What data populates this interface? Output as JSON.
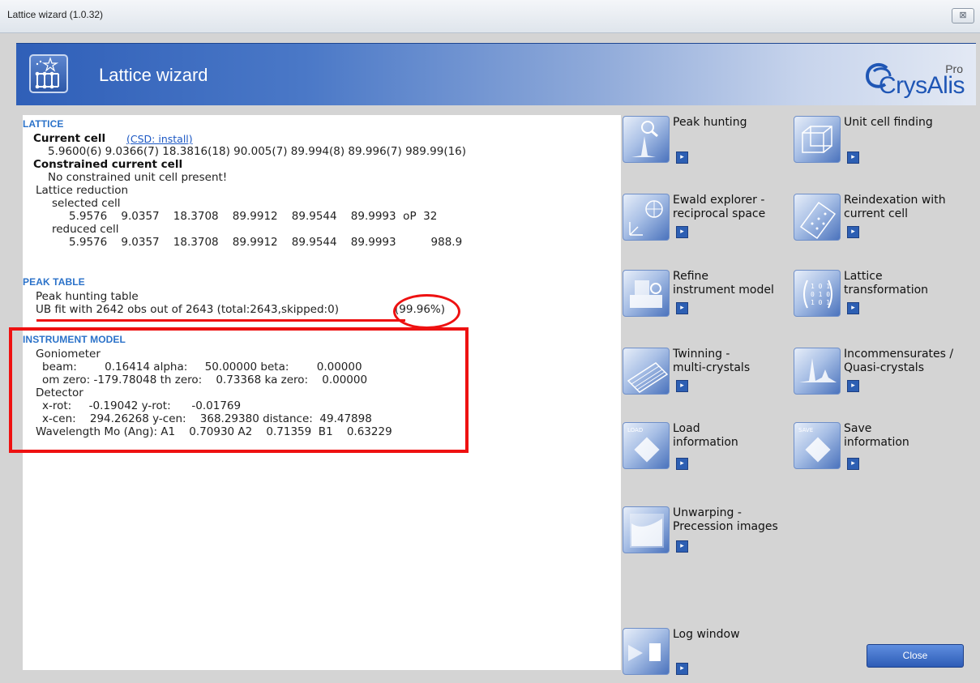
{
  "window": {
    "title": "Lattice wizard (1.0.32)",
    "close_glyph": "⊠"
  },
  "banner": {
    "title": "Lattice wizard",
    "logo_pro": "Pro",
    "logo_name": "CrysAlis",
    "accent": "#2f5fb8"
  },
  "lattice": {
    "heading": "LATTICE",
    "current_cell_label": "Current cell",
    "csd_link": "(CSD: install)",
    "current_cell_values": "5.9600(6) 9.0366(7) 18.3816(18) 90.005(7) 89.994(8) 89.996(7) 989.99(16)",
    "constrained_label": "Constrained current cell",
    "constrained_msg": "No constrained unit cell present!",
    "reduction_label": "Lattice reduction",
    "selected_label": "selected cell",
    "selected_values": "5.9576    9.0357    18.3708    89.9912    89.9544    89.9993  oP  32",
    "reduced_label": "reduced cell",
    "reduced_values": "5.9576    9.0357    18.3708    89.9912    89.9544    89.9993          988.9"
  },
  "peak": {
    "heading": "PEAK TABLE",
    "table_name": "Peak hunting table",
    "ub_fit": "UB fit with 2642 obs out of 2643 (total:2643,skipped:0)",
    "percent": "(99.96%)"
  },
  "instrument": {
    "heading": "INSTRUMENT MODEL",
    "goniometer": "Goniometer",
    "beam_line": "beam:        0.16414 alpha:     50.00000 beta:        0.00000",
    "om_line": "om zero: -179.78048 th zero:    0.73368 ka zero:    0.00000",
    "detector": "Detector",
    "xrot_line": "x-rot:     -0.19042 y-rot:      -0.01769",
    "xcen_line": "x-cen:    294.26268 y-cen:    368.29380 distance:  49.47898",
    "wavelength_line": "Wavelength Mo (Ang): A1    0.70930 A2    0.71359  B1    0.63229"
  },
  "tools": [
    {
      "label": "Peak hunting",
      "icon": "peak-hunting-icon"
    },
    {
      "label": "Unit cell finding",
      "icon": "unit-cell-icon"
    },
    {
      "label": "Ewald explorer -\nreciprocal space",
      "icon": "ewald-icon"
    },
    {
      "label": "Reindexation with\ncurrent cell",
      "icon": "reindex-icon"
    },
    {
      "label": "Refine\ninstrument model",
      "icon": "instrument-icon"
    },
    {
      "label": "Lattice\ntransformation",
      "icon": "matrix-icon"
    },
    {
      "label": "Twinning -\nmulti-crystals",
      "icon": "twinning-icon"
    },
    {
      "label": "Incommensurates /\nQuasi-crystals",
      "icon": "incommensurate-icon"
    },
    {
      "label": "Load\ninformation",
      "icon": "load-icon",
      "badge": "LOAD"
    },
    {
      "label": "Save\ninformation",
      "icon": "save-icon",
      "badge": "SAVE"
    },
    {
      "label": "Unwarping -\nPrecession images",
      "icon": "unwarp-icon"
    },
    {
      "label": "Log window",
      "icon": "log-icon"
    }
  ],
  "close_button": {
    "label": "Close"
  }
}
